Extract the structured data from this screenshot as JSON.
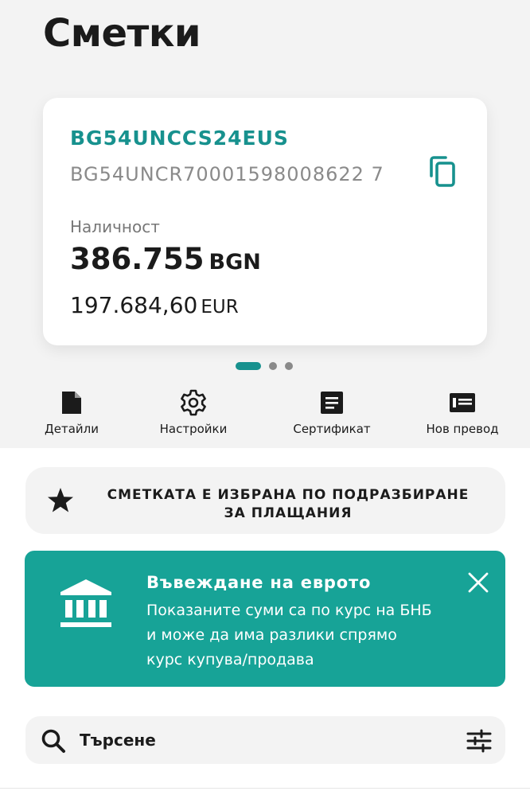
{
  "page": {
    "title": "Сметки"
  },
  "account": {
    "name": "BG54UNCCS24EUS",
    "iban": "BG54UNCR70001598008622 7",
    "balance_label": "Наличност",
    "balance_amount": "386.755",
    "balance_currency": "BGN",
    "secondary_amount": "197.684,60",
    "secondary_currency": "EUR",
    "copy_icon": "copy-icon"
  },
  "pager": {
    "count": 3,
    "active_index": 0
  },
  "actions": [
    {
      "label": "Детайли",
      "icon": "document-icon"
    },
    {
      "label": "Настройки",
      "icon": "gear-icon"
    },
    {
      "label": "Сертификат",
      "icon": "certificate-icon"
    },
    {
      "label": "Нов превод",
      "icon": "transfer-icon"
    }
  ],
  "default_account": {
    "line1": "СМЕТКАТА Е ИЗБРАНА ПО ПОДРАЗБИРАНЕ",
    "line2": "ЗА ПЛАЩАНИЯ",
    "icon": "star-icon"
  },
  "euro_banner": {
    "title": "Въвеждане на еврото",
    "line1": "Показаните суми са по курс на БНБ",
    "line2": "и може да има разлики спрямо",
    "line3": "курс купува/продава",
    "icon": "bank-icon",
    "close_icon": "close-icon"
  },
  "search": {
    "placeholder": "Търсене",
    "value": ""
  },
  "colors": {
    "accent": "#17918e",
    "banner": "#17a397",
    "background": "#f3f3f3",
    "text": "#1b1b1b",
    "muted": "#8a8a8a"
  }
}
